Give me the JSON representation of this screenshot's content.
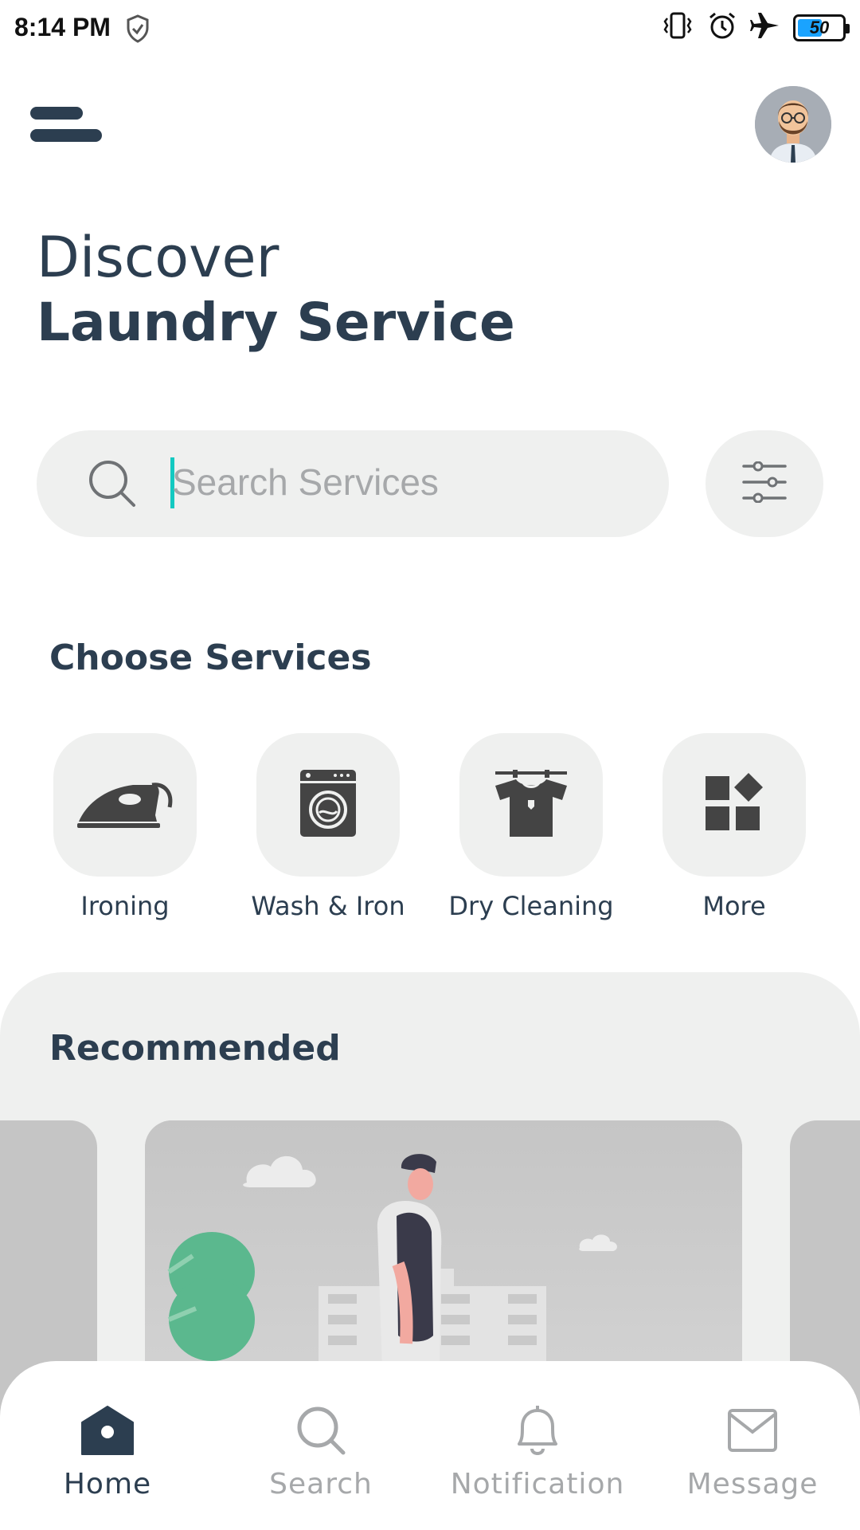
{
  "status_bar": {
    "time": "8:14 PM",
    "battery": "50"
  },
  "header": {
    "greeting": "Discover",
    "title": "Laundry Service"
  },
  "search": {
    "placeholder": "Search Services"
  },
  "services": {
    "title": "Choose Services",
    "items": [
      {
        "label": "Ironing",
        "icon": "iron-icon"
      },
      {
        "label": "Wash & Iron",
        "icon": "washing-machine-icon"
      },
      {
        "label": "Dry Cleaning",
        "icon": "shirt-hanger-icon"
      },
      {
        "label": "More",
        "icon": "grid-icon"
      }
    ]
  },
  "recommended": {
    "title": "Recommended"
  },
  "bottom_nav": {
    "items": [
      {
        "label": "Home",
        "icon": "home-icon",
        "active": true
      },
      {
        "label": "Search",
        "icon": "search-icon",
        "active": false
      },
      {
        "label": "Notification",
        "icon": "bell-icon",
        "active": false
      },
      {
        "label": "Message",
        "icon": "mail-icon",
        "active": false
      }
    ]
  },
  "colors": {
    "primary": "#2c3e50",
    "accent": "#13c9c1",
    "surface": "#eff0ef",
    "muted": "#a6a8aa"
  }
}
